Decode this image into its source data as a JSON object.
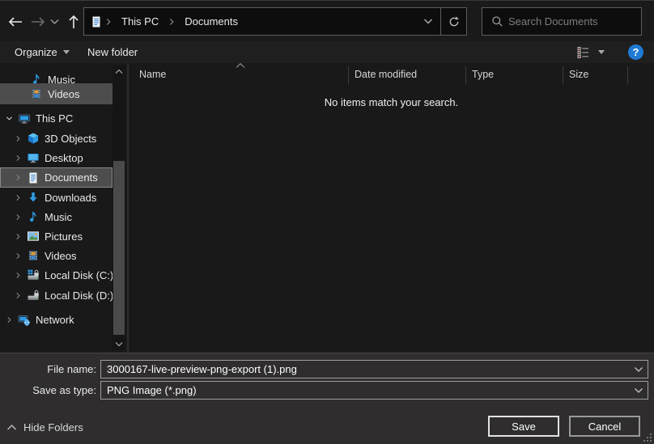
{
  "toolbar": {
    "address": {
      "crumbs": [
        "This PC",
        "Documents"
      ]
    },
    "search_placeholder": "Search Documents"
  },
  "command_bar": {
    "organize_label": "Organize",
    "new_folder_label": "New folder"
  },
  "sidebar": {
    "items": [
      {
        "label": "Music"
      },
      {
        "label": "Videos"
      },
      {
        "label": "This PC"
      },
      {
        "label": "3D Objects"
      },
      {
        "label": "Desktop"
      },
      {
        "label": "Documents"
      },
      {
        "label": "Downloads"
      },
      {
        "label": "Music"
      },
      {
        "label": "Pictures"
      },
      {
        "label": "Videos"
      },
      {
        "label": "Local Disk (C:)"
      },
      {
        "label": "Local Disk (D:)"
      },
      {
        "label": "Network"
      }
    ]
  },
  "columns": [
    "Name",
    "Date modified",
    "Type",
    "Size"
  ],
  "main": {
    "empty_message": "No items match your search."
  },
  "footer": {
    "file_name_label": "File name:",
    "file_name_value": "3000167-live-preview-png-export (1).png",
    "save_as_type_label": "Save as type:",
    "save_as_type_value": "PNG Image (*.png)",
    "hide_folders_label": "Hide Folders",
    "save_label": "Save",
    "cancel_label": "Cancel",
    "help_label": "?"
  },
  "colors": {
    "accent_blue": "#2f9ae3",
    "help_blue": "#1f7ad4",
    "selection_gray": "#4d4d4d"
  }
}
